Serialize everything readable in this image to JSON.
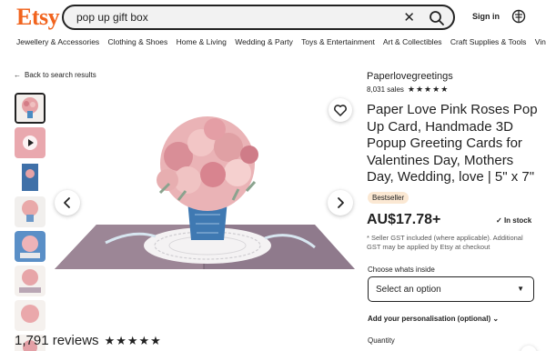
{
  "header": {
    "logo": "Etsy",
    "search_value": "pop up gift box",
    "signin_label": "Sign in",
    "accent_color": "#f1641e"
  },
  "categories": [
    "Jewellery & Accessories",
    "Clothing & Shoes",
    "Home & Living",
    "Wedding & Party",
    "Toys & Entertainment",
    "Art & Collectibles",
    "Craft Supplies & Tools",
    "Vintage"
  ],
  "back_link": "Back to search results",
  "gallery": {
    "thumb_count": 8,
    "icons": [
      "heart-icon",
      "chevron-left-icon",
      "chevron-right-icon",
      "play-icon"
    ]
  },
  "reviews": {
    "count_text": "1,791 reviews",
    "stars": "★★★★★"
  },
  "product": {
    "shop": "Paperlovegreetings",
    "sales": "8,031 sales",
    "stars": "★★★★★",
    "title": "Paper Love Pink Roses Pop Up Card, Handmade 3D Popup Greeting Cards for Valentines Day, Mothers Day, Wedding, love | 5\" x 7\"",
    "badge": "Bestseller",
    "price": "AU$17.78+",
    "stock": "In stock",
    "gst_note": "* Seller GST included (where applicable). Additional GST may be applied by Etsy at checkout",
    "choose_label": "Choose whats inside",
    "select_value": "Select an option",
    "personalisation": "Add your personalisation (optional)",
    "quantity_label": "Quantity"
  }
}
